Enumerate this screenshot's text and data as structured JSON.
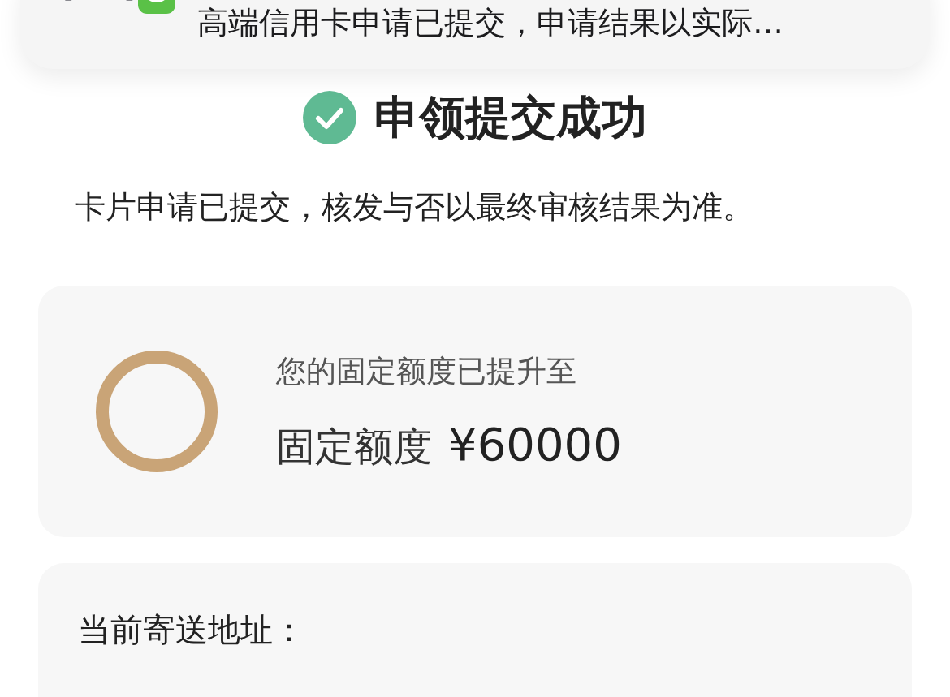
{
  "notification": {
    "message": "高端信用卡申请已提交，申请结果以实际…"
  },
  "header": {
    "title": "申领提交成功"
  },
  "notice": "卡片申请已提交，核发与否以最终审核结果为准。",
  "limit_card": {
    "label": "您的固定额度已提升至",
    "amount_label": "固定额度",
    "amount": "¥60000"
  },
  "address_card": {
    "label": "当前寄送地址："
  }
}
